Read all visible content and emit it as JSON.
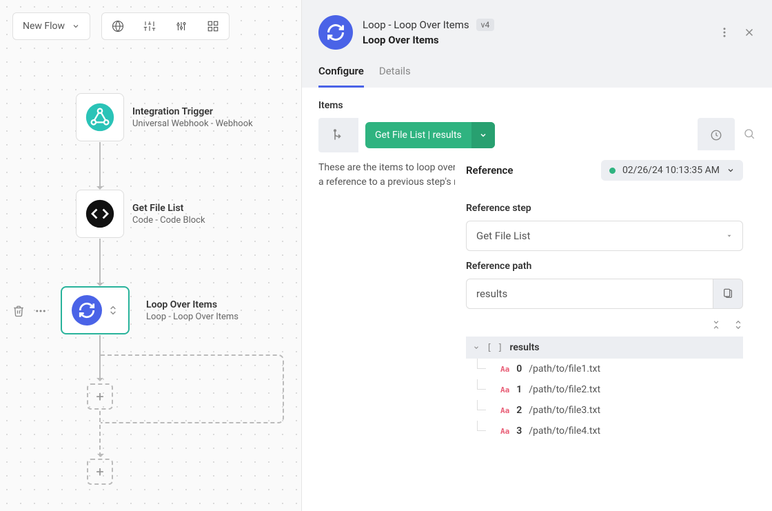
{
  "toolbar": {
    "flow_name": "New Flow"
  },
  "nodes": {
    "trigger": {
      "title": "Integration Trigger",
      "subtitle": "Universal Webhook - Webhook"
    },
    "code": {
      "title": "Get File List",
      "subtitle": "Code - Code Block"
    },
    "loop": {
      "title": "Loop Over Items",
      "subtitle": "Loop - Loop Over Items"
    }
  },
  "panel": {
    "name": "Loop - Loop Over Items",
    "version": "v4",
    "type": "Loop Over Items",
    "tabs": {
      "configure": "Configure",
      "details": "Details"
    },
    "items_label": "Items",
    "ref_pill": "Get File List | results",
    "help": "These are the items to loop over. This should be a reference to a previous step's results."
  },
  "reference": {
    "title": "Reference",
    "timestamp": "02/26/24 10:13:35 AM",
    "step_label": "Reference step",
    "step_value": "Get File List",
    "path_label": "Reference path",
    "path_value": "results",
    "root_name": "results",
    "results": [
      {
        "idx": "0",
        "value": "/path/to/file1.txt"
      },
      {
        "idx": "1",
        "value": "/path/to/file2.txt"
      },
      {
        "idx": "2",
        "value": "/path/to/file3.txt"
      },
      {
        "idx": "3",
        "value": "/path/to/file4.txt"
      }
    ]
  }
}
